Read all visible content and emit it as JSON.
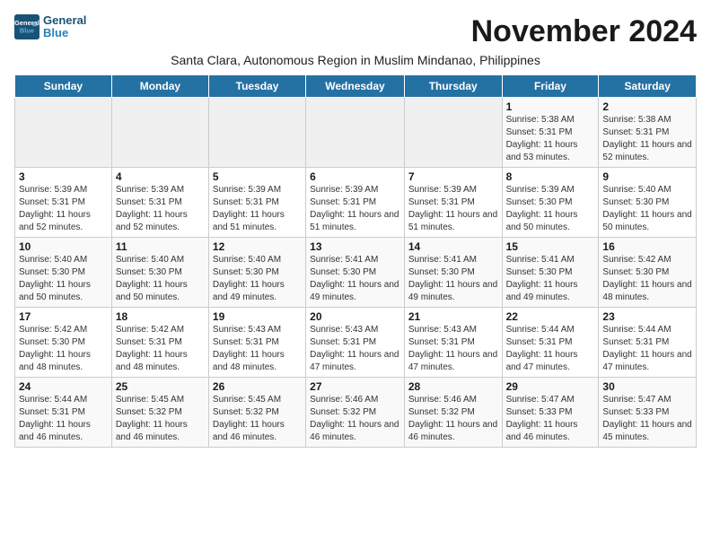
{
  "logo": {
    "general": "General",
    "blue": "Blue"
  },
  "title": "November 2024",
  "subtitle": "Santa Clara, Autonomous Region in Muslim Mindanao, Philippines",
  "days_header": [
    "Sunday",
    "Monday",
    "Tuesday",
    "Wednesday",
    "Thursday",
    "Friday",
    "Saturday"
  ],
  "weeks": [
    [
      {
        "num": "",
        "info": ""
      },
      {
        "num": "",
        "info": ""
      },
      {
        "num": "",
        "info": ""
      },
      {
        "num": "",
        "info": ""
      },
      {
        "num": "",
        "info": ""
      },
      {
        "num": "1",
        "info": "Sunrise: 5:38 AM\nSunset: 5:31 PM\nDaylight: 11 hours and 53 minutes."
      },
      {
        "num": "2",
        "info": "Sunrise: 5:38 AM\nSunset: 5:31 PM\nDaylight: 11 hours and 52 minutes."
      }
    ],
    [
      {
        "num": "3",
        "info": "Sunrise: 5:39 AM\nSunset: 5:31 PM\nDaylight: 11 hours and 52 minutes."
      },
      {
        "num": "4",
        "info": "Sunrise: 5:39 AM\nSunset: 5:31 PM\nDaylight: 11 hours and 52 minutes."
      },
      {
        "num": "5",
        "info": "Sunrise: 5:39 AM\nSunset: 5:31 PM\nDaylight: 11 hours and 51 minutes."
      },
      {
        "num": "6",
        "info": "Sunrise: 5:39 AM\nSunset: 5:31 PM\nDaylight: 11 hours and 51 minutes."
      },
      {
        "num": "7",
        "info": "Sunrise: 5:39 AM\nSunset: 5:31 PM\nDaylight: 11 hours and 51 minutes."
      },
      {
        "num": "8",
        "info": "Sunrise: 5:39 AM\nSunset: 5:30 PM\nDaylight: 11 hours and 50 minutes."
      },
      {
        "num": "9",
        "info": "Sunrise: 5:40 AM\nSunset: 5:30 PM\nDaylight: 11 hours and 50 minutes."
      }
    ],
    [
      {
        "num": "10",
        "info": "Sunrise: 5:40 AM\nSunset: 5:30 PM\nDaylight: 11 hours and 50 minutes."
      },
      {
        "num": "11",
        "info": "Sunrise: 5:40 AM\nSunset: 5:30 PM\nDaylight: 11 hours and 50 minutes."
      },
      {
        "num": "12",
        "info": "Sunrise: 5:40 AM\nSunset: 5:30 PM\nDaylight: 11 hours and 49 minutes."
      },
      {
        "num": "13",
        "info": "Sunrise: 5:41 AM\nSunset: 5:30 PM\nDaylight: 11 hours and 49 minutes."
      },
      {
        "num": "14",
        "info": "Sunrise: 5:41 AM\nSunset: 5:30 PM\nDaylight: 11 hours and 49 minutes."
      },
      {
        "num": "15",
        "info": "Sunrise: 5:41 AM\nSunset: 5:30 PM\nDaylight: 11 hours and 49 minutes."
      },
      {
        "num": "16",
        "info": "Sunrise: 5:42 AM\nSunset: 5:30 PM\nDaylight: 11 hours and 48 minutes."
      }
    ],
    [
      {
        "num": "17",
        "info": "Sunrise: 5:42 AM\nSunset: 5:30 PM\nDaylight: 11 hours and 48 minutes."
      },
      {
        "num": "18",
        "info": "Sunrise: 5:42 AM\nSunset: 5:31 PM\nDaylight: 11 hours and 48 minutes."
      },
      {
        "num": "19",
        "info": "Sunrise: 5:43 AM\nSunset: 5:31 PM\nDaylight: 11 hours and 48 minutes."
      },
      {
        "num": "20",
        "info": "Sunrise: 5:43 AM\nSunset: 5:31 PM\nDaylight: 11 hours and 47 minutes."
      },
      {
        "num": "21",
        "info": "Sunrise: 5:43 AM\nSunset: 5:31 PM\nDaylight: 11 hours and 47 minutes."
      },
      {
        "num": "22",
        "info": "Sunrise: 5:44 AM\nSunset: 5:31 PM\nDaylight: 11 hours and 47 minutes."
      },
      {
        "num": "23",
        "info": "Sunrise: 5:44 AM\nSunset: 5:31 PM\nDaylight: 11 hours and 47 minutes."
      }
    ],
    [
      {
        "num": "24",
        "info": "Sunrise: 5:44 AM\nSunset: 5:31 PM\nDaylight: 11 hours and 46 minutes."
      },
      {
        "num": "25",
        "info": "Sunrise: 5:45 AM\nSunset: 5:32 PM\nDaylight: 11 hours and 46 minutes."
      },
      {
        "num": "26",
        "info": "Sunrise: 5:45 AM\nSunset: 5:32 PM\nDaylight: 11 hours and 46 minutes."
      },
      {
        "num": "27",
        "info": "Sunrise: 5:46 AM\nSunset: 5:32 PM\nDaylight: 11 hours and 46 minutes."
      },
      {
        "num": "28",
        "info": "Sunrise: 5:46 AM\nSunset: 5:32 PM\nDaylight: 11 hours and 46 minutes."
      },
      {
        "num": "29",
        "info": "Sunrise: 5:47 AM\nSunset: 5:33 PM\nDaylight: 11 hours and 46 minutes."
      },
      {
        "num": "30",
        "info": "Sunrise: 5:47 AM\nSunset: 5:33 PM\nDaylight: 11 hours and 45 minutes."
      }
    ]
  ]
}
